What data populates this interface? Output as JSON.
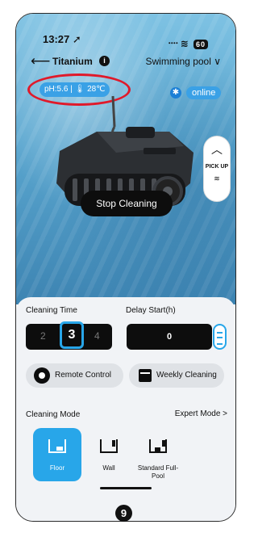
{
  "status_bar": {
    "time": "13:27 ➚",
    "signal_wifi": "᠁ ≋",
    "battery": "60"
  },
  "nav": {
    "back_symbol": "⟵",
    "title": "Titanium",
    "info_symbol": "i",
    "pool_selector": "Swimming pool ∨"
  },
  "readings": {
    "text": "pH:5.6 | 🌡 28℃"
  },
  "connection": {
    "bluetooth_symbol": "✱",
    "status": "online"
  },
  "pickup": {
    "label": "PICK UP",
    "up_symbol": "︿",
    "wave_symbol": "≋"
  },
  "stop_button": {
    "label": "Stop Cleaning"
  },
  "panel": {
    "cleaning_time_label": "Cleaning Time",
    "delay_start_label": "Delay Start(h)",
    "cleaning_time": {
      "prev": "2",
      "selected": "3",
      "next": "4"
    },
    "delay_value": "0",
    "remote_label": "Remote Control",
    "weekly_label": "Weekly Cleaning",
    "cleaning_mode_label": "Cleaning Mode",
    "expert_label": "Expert Mode  >",
    "modes": [
      {
        "name": "Floor",
        "selected": true
      },
      {
        "name": "Wall",
        "selected": false
      },
      {
        "name": "Standard Full-Pool",
        "selected": false
      }
    ]
  },
  "annotation": {
    "step_number": "9"
  },
  "colors": {
    "accent": "#28a6e9",
    "highlight_ring": "#e0192a",
    "dark": "#0d0d0d",
    "panel_bg": "#f1f3f6"
  }
}
